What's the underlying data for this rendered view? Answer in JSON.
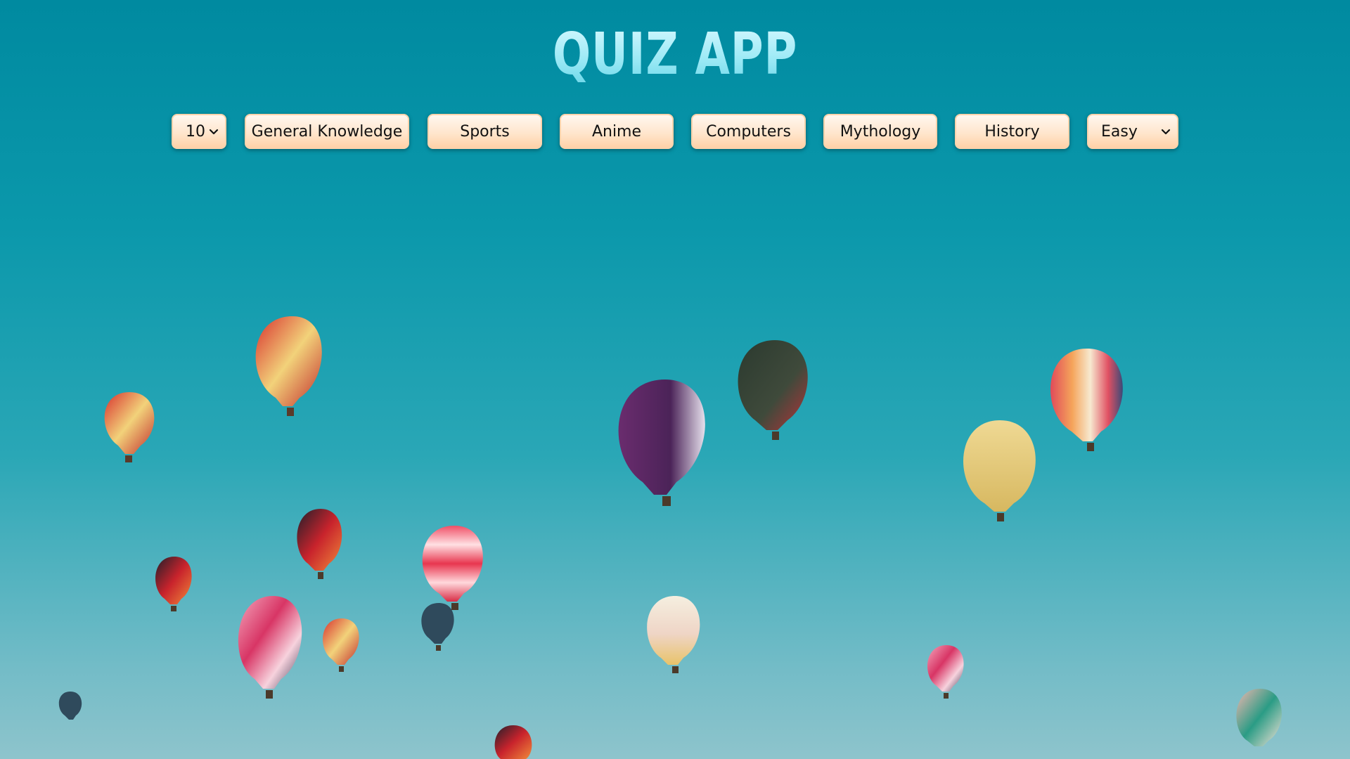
{
  "app": {
    "title": "QUIZ APP"
  },
  "controls": {
    "amount_select": {
      "value": "10"
    },
    "categories": [
      {
        "label": "General Knowledge"
      },
      {
        "label": "Sports"
      },
      {
        "label": "Anime"
      },
      {
        "label": "Computers"
      },
      {
        "label": "Mythology"
      },
      {
        "label": "History"
      }
    ],
    "difficulty_select": {
      "value": "Easy"
    }
  },
  "background": {
    "description_icon": "hot-air-balloons-photo",
    "sky_top_color": "#008aa0",
    "sky_bottom_color": "#8ec4cc"
  },
  "theme": {
    "button_color": "#ffe6cd",
    "title_color": "#9eeaf6"
  }
}
